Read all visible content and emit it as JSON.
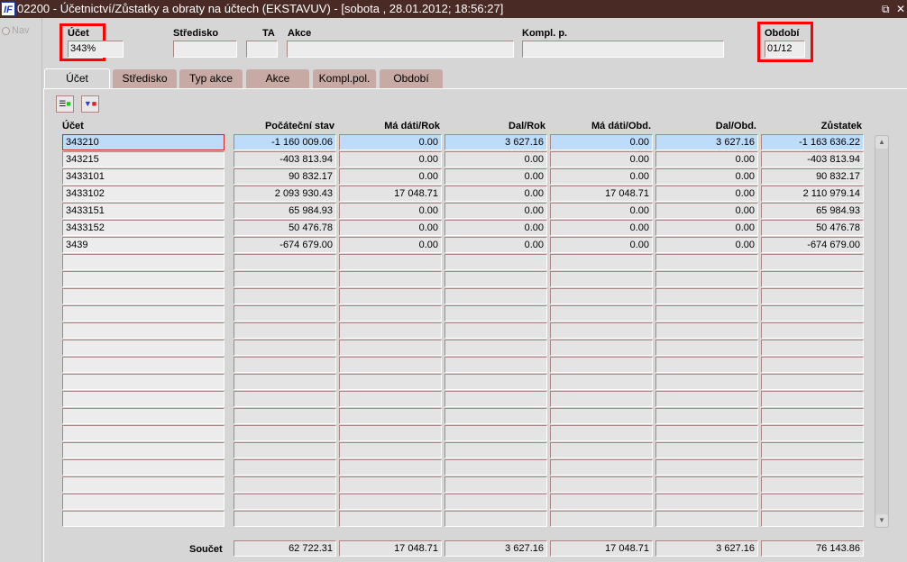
{
  "title": "02200 - Účetnictví/Zůstatky a obraty na účtech (EKSTAVUV) - [sobota , 28.01.2012; 18:56:27]",
  "logo": "IF",
  "nav": {
    "label": "Nav"
  },
  "filters": {
    "ucet": {
      "label": "Účet",
      "value": "343%"
    },
    "stredisko": {
      "label": "Středisko",
      "value": ""
    },
    "ta": {
      "label": "TA",
      "value": ""
    },
    "akce": {
      "label": "Akce",
      "value": ""
    },
    "kompl": {
      "label": "Kompl. p.",
      "value": ""
    },
    "obdobi": {
      "label": "Období",
      "value": "01/12"
    }
  },
  "tabs": [
    "Účet",
    "Středisko",
    "Typ akce",
    "Akce",
    "Kompl.pol.",
    "Období"
  ],
  "columns": [
    "Účet",
    "Počáteční stav",
    "Má dáti/Rok",
    "Dal/Rok",
    "Má dáti/Obd.",
    "Dal/Obd.",
    "Zůstatek"
  ],
  "rows": [
    [
      "343210",
      "-1 160 009.06",
      "0.00",
      "3 627.16",
      "0.00",
      "3 627.16",
      "-1 163 636.22"
    ],
    [
      "343215",
      "-403 813.94",
      "0.00",
      "0.00",
      "0.00",
      "0.00",
      "-403 813.94"
    ],
    [
      "3433101",
      "90 832.17",
      "0.00",
      "0.00",
      "0.00",
      "0.00",
      "90 832.17"
    ],
    [
      "3433102",
      "2 093 930.43",
      "17 048.71",
      "0.00",
      "17 048.71",
      "0.00",
      "2 110 979.14"
    ],
    [
      "3433151",
      "65 984.93",
      "0.00",
      "0.00",
      "0.00",
      "0.00",
      "65 984.93"
    ],
    [
      "3433152",
      "50 476.78",
      "0.00",
      "0.00",
      "0.00",
      "0.00",
      "50 476.78"
    ],
    [
      "3439",
      "-674 679.00",
      "0.00",
      "0.00",
      "0.00",
      "0.00",
      "-674 679.00"
    ]
  ],
  "empty_rows": 16,
  "totals": {
    "label": "Součet",
    "values": [
      "62 722.31",
      "17 048.71",
      "3 627.16",
      "17 048.71",
      "3 627.16",
      "76 143.86"
    ]
  }
}
